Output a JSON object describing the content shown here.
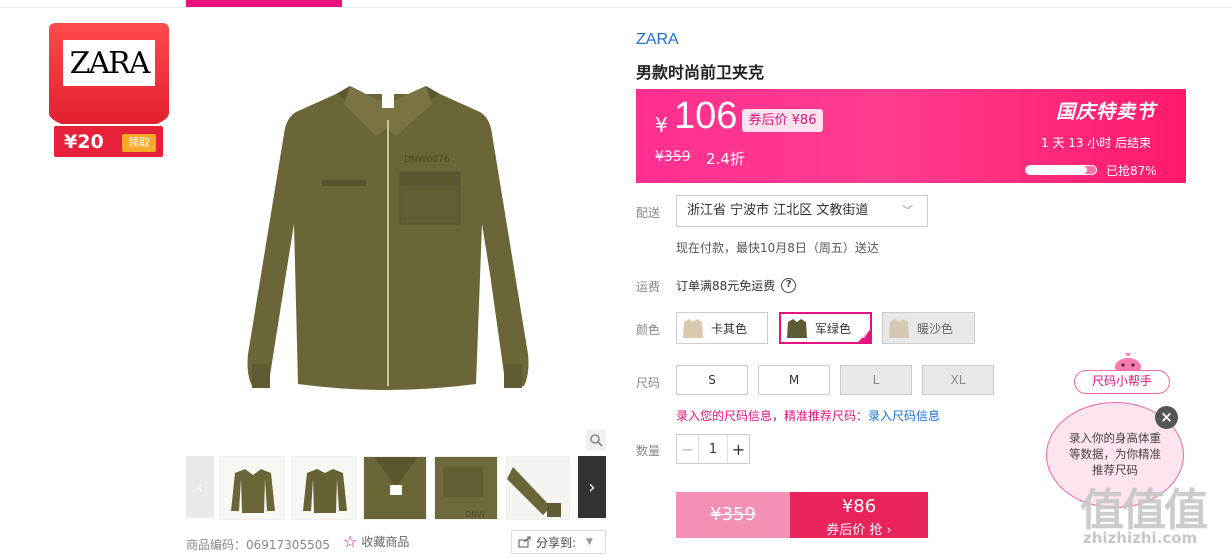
{
  "coupon": {
    "logo_text": "ZARA",
    "amount": "¥20",
    "get_label": "领取"
  },
  "product": {
    "brand": "ZARA",
    "title": "男款时尚前卫夹克",
    "code_label": "商品编码：06917305505",
    "favorite_label": "收藏商品",
    "share_label": "分享到:"
  },
  "price": {
    "currency": "¥",
    "current": "106",
    "coupon_price": "券后价 ¥86",
    "original": "¥359",
    "discount": "2.4折",
    "festival": "国庆特卖节",
    "countdown": "1 天 13 小时 后结束",
    "sold_label": "已抢87%",
    "sold_percent": 87
  },
  "delivery": {
    "label": "配送",
    "address": "浙江省 宁波市 江北区 文教街道",
    "note": "现在付款，最快10月8日（周五）送达"
  },
  "freight": {
    "label": "运费",
    "text": "订单满88元免运费",
    "help": "?"
  },
  "colors": {
    "label": "颜色",
    "options": [
      {
        "name": "卡其色",
        "swatch": "#d9c9ae"
      },
      {
        "name": "军绿色",
        "swatch": "#5d5a36"
      },
      {
        "name": "暖沙色",
        "swatch": "#d5c8b3"
      }
    ]
  },
  "sizes": {
    "label": "尺码",
    "options": [
      "S",
      "M",
      "L",
      "XL"
    ],
    "tip": "录入您的尺码信息，精准推荐尺码：",
    "tip_link": "录入尺码信息"
  },
  "quantity": {
    "label": "数量",
    "value": "1",
    "minus": "−",
    "plus": "+"
  },
  "buy": {
    "original": "¥359",
    "price": "¥86",
    "action": "券后价 抢 ›"
  },
  "helper": {
    "title": "尺码小帮手",
    "text": "录入你的身高体重等数据，为你精准推荐尺码",
    "close": "×"
  },
  "watermark": {
    "text": "值值值",
    "url": "zhizhizhi.com"
  },
  "theme": {
    "accent": "#e6127d",
    "link": "#1a6fd8",
    "jacket": "#6b6638"
  }
}
